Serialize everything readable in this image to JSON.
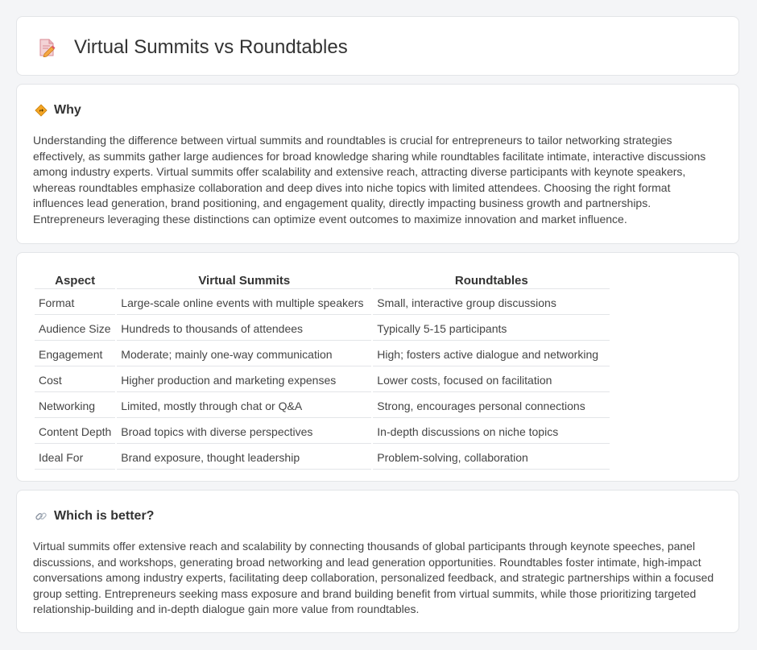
{
  "page": {
    "title": "Virtual Summits vs Roundtables",
    "icon": "document-pencil-icon"
  },
  "why": {
    "icon": "road-sign-icon",
    "title": "Why",
    "text": "Understanding the difference between virtual summits and roundtables is crucial for entrepreneurs to tailor networking strategies effectively, as summits gather large audiences for broad knowledge sharing while roundtables facilitate intimate, interactive discussions among industry experts. Virtual summits offer scalability and extensive reach, attracting diverse participants with keynote speakers, whereas roundtables emphasize collaboration and deep dives into niche topics with limited attendees. Choosing the right format influences lead generation, brand positioning, and engagement quality, directly impacting business growth and partnerships. Entrepreneurs leveraging these distinctions can optimize event outcomes to maximize innovation and market influence."
  },
  "table": {
    "headers": [
      "Aspect",
      "Virtual Summits",
      "Roundtables"
    ],
    "rows": [
      [
        "Format",
        "Large-scale online events with multiple speakers",
        "Small, interactive group discussions"
      ],
      [
        "Audience Size",
        "Hundreds to thousands of attendees",
        "Typically 5-15 participants"
      ],
      [
        "Engagement",
        "Moderate; mainly one-way communication",
        "High; fosters active dialogue and networking"
      ],
      [
        "Cost",
        "Higher production and marketing expenses",
        "Lower costs, focused on facilitation"
      ],
      [
        "Networking",
        "Limited, mostly through chat or Q&A",
        "Strong, encourages personal connections"
      ],
      [
        "Content Depth",
        "Broad topics with diverse perspectives",
        "In-depth discussions on niche topics"
      ],
      [
        "Ideal For",
        "Brand exposure, thought leadership",
        "Problem-solving, collaboration"
      ]
    ]
  },
  "better": {
    "icon": "link-icon",
    "title": "Which is better?",
    "text": "Virtual summits offer extensive reach and scalability by connecting thousands of global participants through keynote speeches, panel discussions, and workshops, generating broad networking and lead generation opportunities. Roundtables foster intimate, high-impact conversations among industry experts, facilitating deep collaboration, personalized feedback, and strategic partnerships within a focused group setting. Entrepreneurs seeking mass exposure and brand building benefit from virtual summits, while those prioritizing targeted relationship-building and in-depth dialogue gain more value from roundtables."
  }
}
